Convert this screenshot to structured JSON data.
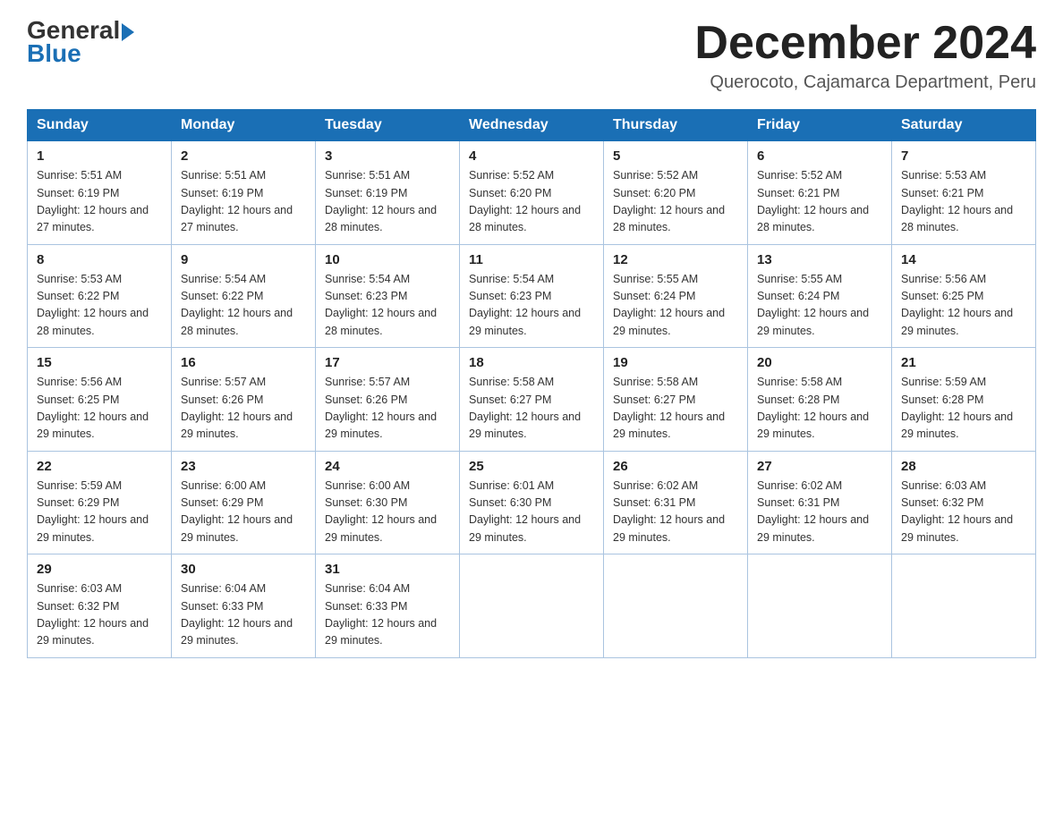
{
  "header": {
    "logo_line1": "General",
    "logo_line2": "Blue",
    "month_title": "December 2024",
    "location": "Querocoto, Cajamarca Department, Peru"
  },
  "weekdays": [
    "Sunday",
    "Monday",
    "Tuesday",
    "Wednesday",
    "Thursday",
    "Friday",
    "Saturday"
  ],
  "weeks": [
    [
      {
        "day": "1",
        "sunrise": "5:51 AM",
        "sunset": "6:19 PM",
        "daylight": "12 hours and 27 minutes."
      },
      {
        "day": "2",
        "sunrise": "5:51 AM",
        "sunset": "6:19 PM",
        "daylight": "12 hours and 27 minutes."
      },
      {
        "day": "3",
        "sunrise": "5:51 AM",
        "sunset": "6:19 PM",
        "daylight": "12 hours and 28 minutes."
      },
      {
        "day": "4",
        "sunrise": "5:52 AM",
        "sunset": "6:20 PM",
        "daylight": "12 hours and 28 minutes."
      },
      {
        "day": "5",
        "sunrise": "5:52 AM",
        "sunset": "6:20 PM",
        "daylight": "12 hours and 28 minutes."
      },
      {
        "day": "6",
        "sunrise": "5:52 AM",
        "sunset": "6:21 PM",
        "daylight": "12 hours and 28 minutes."
      },
      {
        "day": "7",
        "sunrise": "5:53 AM",
        "sunset": "6:21 PM",
        "daylight": "12 hours and 28 minutes."
      }
    ],
    [
      {
        "day": "8",
        "sunrise": "5:53 AM",
        "sunset": "6:22 PM",
        "daylight": "12 hours and 28 minutes."
      },
      {
        "day": "9",
        "sunrise": "5:54 AM",
        "sunset": "6:22 PM",
        "daylight": "12 hours and 28 minutes."
      },
      {
        "day": "10",
        "sunrise": "5:54 AM",
        "sunset": "6:23 PM",
        "daylight": "12 hours and 28 minutes."
      },
      {
        "day": "11",
        "sunrise": "5:54 AM",
        "sunset": "6:23 PM",
        "daylight": "12 hours and 29 minutes."
      },
      {
        "day": "12",
        "sunrise": "5:55 AM",
        "sunset": "6:24 PM",
        "daylight": "12 hours and 29 minutes."
      },
      {
        "day": "13",
        "sunrise": "5:55 AM",
        "sunset": "6:24 PM",
        "daylight": "12 hours and 29 minutes."
      },
      {
        "day": "14",
        "sunrise": "5:56 AM",
        "sunset": "6:25 PM",
        "daylight": "12 hours and 29 minutes."
      }
    ],
    [
      {
        "day": "15",
        "sunrise": "5:56 AM",
        "sunset": "6:25 PM",
        "daylight": "12 hours and 29 minutes."
      },
      {
        "day": "16",
        "sunrise": "5:57 AM",
        "sunset": "6:26 PM",
        "daylight": "12 hours and 29 minutes."
      },
      {
        "day": "17",
        "sunrise": "5:57 AM",
        "sunset": "6:26 PM",
        "daylight": "12 hours and 29 minutes."
      },
      {
        "day": "18",
        "sunrise": "5:58 AM",
        "sunset": "6:27 PM",
        "daylight": "12 hours and 29 minutes."
      },
      {
        "day": "19",
        "sunrise": "5:58 AM",
        "sunset": "6:27 PM",
        "daylight": "12 hours and 29 minutes."
      },
      {
        "day": "20",
        "sunrise": "5:58 AM",
        "sunset": "6:28 PM",
        "daylight": "12 hours and 29 minutes."
      },
      {
        "day": "21",
        "sunrise": "5:59 AM",
        "sunset": "6:28 PM",
        "daylight": "12 hours and 29 minutes."
      }
    ],
    [
      {
        "day": "22",
        "sunrise": "5:59 AM",
        "sunset": "6:29 PM",
        "daylight": "12 hours and 29 minutes."
      },
      {
        "day": "23",
        "sunrise": "6:00 AM",
        "sunset": "6:29 PM",
        "daylight": "12 hours and 29 minutes."
      },
      {
        "day": "24",
        "sunrise": "6:00 AM",
        "sunset": "6:30 PM",
        "daylight": "12 hours and 29 minutes."
      },
      {
        "day": "25",
        "sunrise": "6:01 AM",
        "sunset": "6:30 PM",
        "daylight": "12 hours and 29 minutes."
      },
      {
        "day": "26",
        "sunrise": "6:02 AM",
        "sunset": "6:31 PM",
        "daylight": "12 hours and 29 minutes."
      },
      {
        "day": "27",
        "sunrise": "6:02 AM",
        "sunset": "6:31 PM",
        "daylight": "12 hours and 29 minutes."
      },
      {
        "day": "28",
        "sunrise": "6:03 AM",
        "sunset": "6:32 PM",
        "daylight": "12 hours and 29 minutes."
      }
    ],
    [
      {
        "day": "29",
        "sunrise": "6:03 AM",
        "sunset": "6:32 PM",
        "daylight": "12 hours and 29 minutes."
      },
      {
        "day": "30",
        "sunrise": "6:04 AM",
        "sunset": "6:33 PM",
        "daylight": "12 hours and 29 minutes."
      },
      {
        "day": "31",
        "sunrise": "6:04 AM",
        "sunset": "6:33 PM",
        "daylight": "12 hours and 29 minutes."
      },
      null,
      null,
      null,
      null
    ]
  ]
}
